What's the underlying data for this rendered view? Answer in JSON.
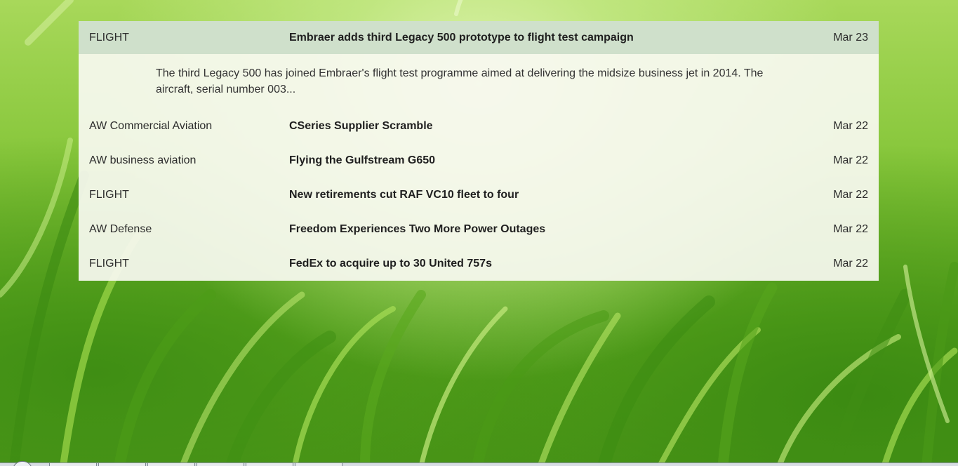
{
  "news": {
    "items": [
      {
        "source": "FLIGHT",
        "title": "Embraer adds third Legacy 500 prototype to flight test campaign",
        "date": "Mar 23",
        "summary": "The third Legacy 500 has joined Embraer's flight test programme aimed at delivering the midsize business jet in 2014. The aircraft, serial number 003..."
      },
      {
        "source": "AW Commercial Aviation",
        "title": "CSeries Supplier Scramble",
        "date": "Mar 22"
      },
      {
        "source": "AW business aviation",
        "title": "Flying the Gulfstream G650",
        "date": "Mar 22"
      },
      {
        "source": "FLIGHT",
        "title": "New retirements cut RAF VC10 fleet to four",
        "date": "Mar 22"
      },
      {
        "source": "AW Defense",
        "title": "Freedom Experiences Two More Power Outages",
        "date": "Mar 22"
      },
      {
        "source": "FLIGHT",
        "title": "FedEx to acquire up to 30 United 757s",
        "date": "Mar 22"
      }
    ]
  },
  "colors": {
    "highlight_row": "#cfe0cb",
    "panel": "#f7f9f0",
    "text": "#2b2b2b"
  }
}
